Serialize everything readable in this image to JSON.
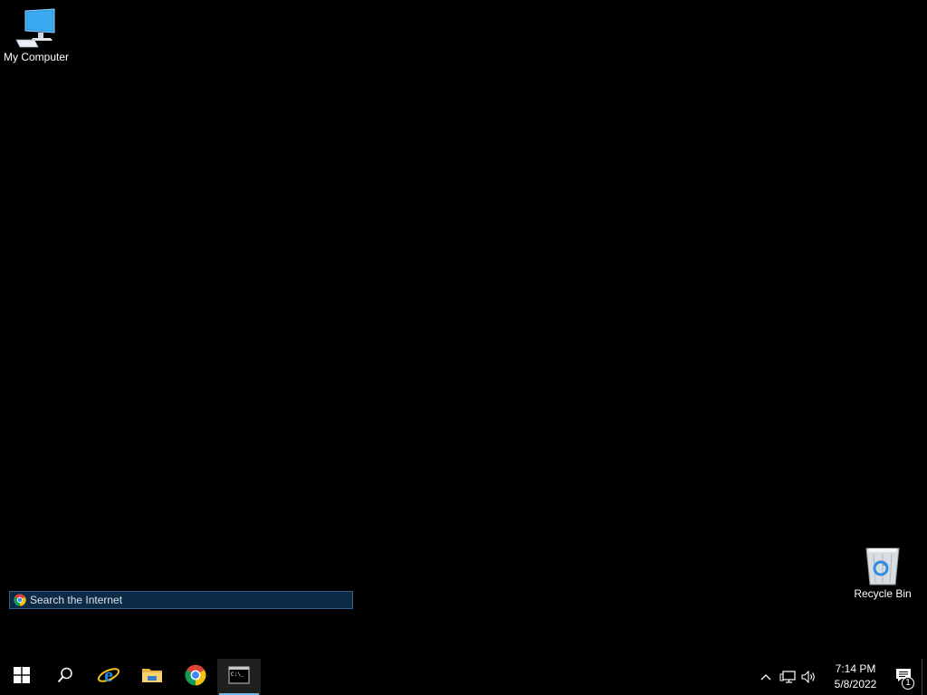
{
  "desktop": {
    "icons": [
      {
        "label": "My Computer",
        "icon": "computer-icon"
      },
      {
        "label": "Recycle Bin",
        "icon": "recycle-bin-icon"
      }
    ],
    "search_widget": {
      "placeholder": "Search the Internet",
      "icon": "chrome-icon"
    }
  },
  "taskbar": {
    "buttons": [
      {
        "name": "start",
        "icon": "windows-logo-icon"
      },
      {
        "name": "search",
        "icon": "search-icon"
      },
      {
        "name": "internet-explorer",
        "icon": "internet-explorer-icon"
      },
      {
        "name": "file-explorer",
        "icon": "folder-icon"
      },
      {
        "name": "chrome",
        "icon": "chrome-icon"
      },
      {
        "name": "command-prompt",
        "icon": "terminal-icon",
        "active": true
      }
    ],
    "tray": {
      "icons": [
        "chevron-up-icon",
        "network-icon",
        "volume-icon"
      ],
      "time": "7:14 PM",
      "date": "5/8/2022",
      "notification_count": "1"
    }
  },
  "colors": {
    "accent": "#76b9ed",
    "search_bg": "#0c2a45",
    "desktop_bg": "#000000"
  }
}
